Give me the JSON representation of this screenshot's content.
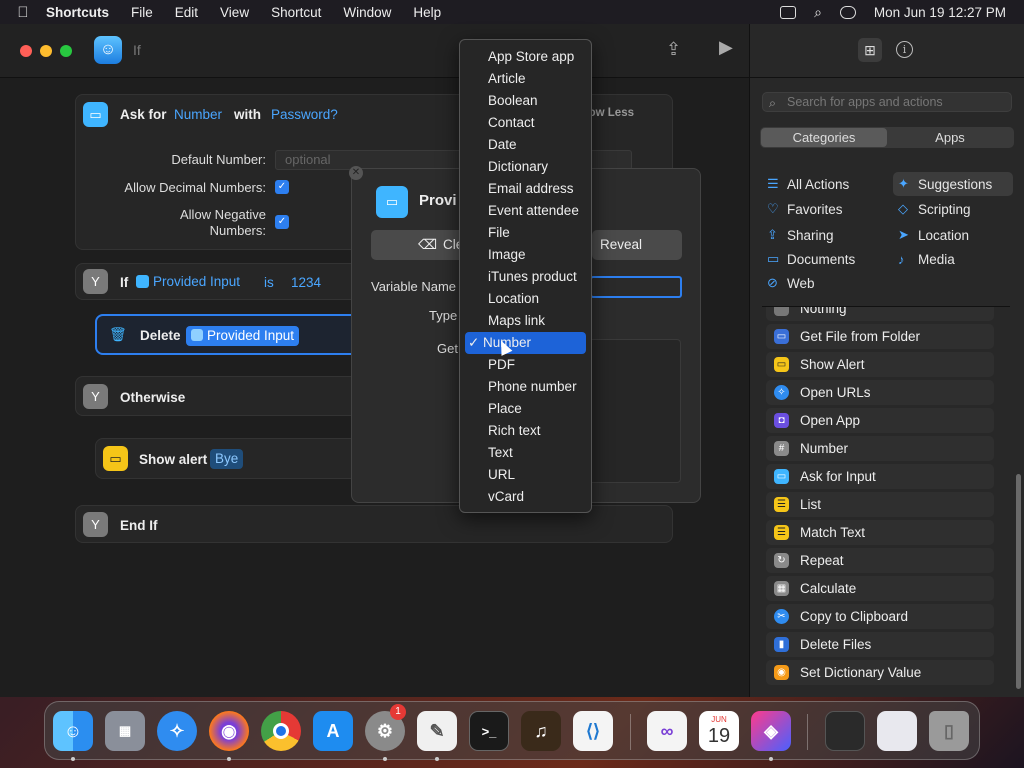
{
  "menubar": {
    "app": "Shortcuts",
    "items": [
      "File",
      "Edit",
      "View",
      "Shortcut",
      "Window",
      "Help"
    ],
    "clock": "Mon Jun 19  12:27 PM"
  },
  "window": {
    "title": "If"
  },
  "editor": {
    "ask": {
      "label": "Ask for",
      "type_token": "Number",
      "with": "with",
      "password_token": "Password?",
      "show_less": "Show Less",
      "default_number_label": "Default Number:",
      "default_number_placeholder": "optional",
      "allow_decimal_label": "Allow Decimal Numbers:",
      "allow_negative_label": "Allow Negative Numbers:",
      "check": "✓"
    },
    "if": {
      "label": "If",
      "input_token": "Provided Input",
      "op": "is",
      "value": "1234"
    },
    "delete": {
      "label": "Delete",
      "input_token": "Provided Input"
    },
    "otherwise": "Otherwise",
    "show_alert": {
      "label": "Show alert",
      "token": "Bye"
    },
    "end_if": "End If"
  },
  "popover": {
    "title": "Provi",
    "clear_label": "Cle",
    "reveal_label": "Reveal",
    "variable_name_label": "Variable Name",
    "type_label": "Type",
    "get_label": "Get"
  },
  "type_menu": {
    "items": [
      "App Store app",
      "Article",
      "Boolean",
      "Contact",
      "Date",
      "Dictionary",
      "Email address",
      "Event attendee",
      "File",
      "Image",
      "iTunes product",
      "Location",
      "Maps link",
      "Number",
      "PDF",
      "Phone number",
      "Place",
      "Rich text",
      "Text",
      "URL",
      "vCard"
    ],
    "selected": "Number",
    "check": "✓"
  },
  "sidebar": {
    "search_placeholder": "Search for apps and actions",
    "seg_categories": "Categories",
    "seg_apps": "Apps",
    "categories": {
      "all_actions": "All Actions",
      "suggestions": "Suggestions",
      "favorites": "Favorites",
      "scripting": "Scripting",
      "sharing": "Sharing",
      "location": "Location",
      "documents": "Documents",
      "media": "Media",
      "web": "Web"
    },
    "actions": [
      "Nothing",
      "Get File from Folder",
      "Show Alert",
      "Open URLs",
      "Open App",
      "Number",
      "Ask for Input",
      "List",
      "Match Text",
      "Repeat",
      "Calculate",
      "Copy to Clipboard",
      "Delete Files",
      "Set Dictionary Value"
    ]
  },
  "dock": {
    "calendar_month": "JUN",
    "calendar_day": "19",
    "settings_badge": "1"
  },
  "colors": {
    "accent": "#2d7ff0",
    "menu_selection": "#1d63d8",
    "token": "#4aa6ff"
  }
}
